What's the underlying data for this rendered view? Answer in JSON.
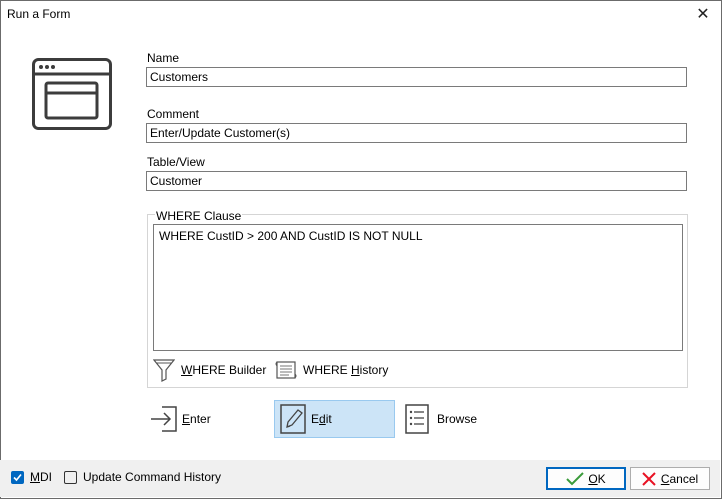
{
  "window": {
    "title": "Run a Form"
  },
  "fields": {
    "name": {
      "label": "Name",
      "value": "Customers"
    },
    "comment": {
      "label": "Comment",
      "value": "Enter/Update Customer(s)"
    },
    "table": {
      "label": "Table/View",
      "value": "Customer"
    }
  },
  "where": {
    "group_label": "WHERE Clause",
    "clause": "WHERE  CustID  > 200 AND  CustID  IS NOT NULL",
    "builder_hotkey": "W",
    "builder_rest": "HERE Builder",
    "history_prefix": "WHERE ",
    "history_hotkey": "H",
    "history_rest": "istory"
  },
  "modes": {
    "enter_hotkey": "E",
    "enter_rest": "nter",
    "edit_pre": "E",
    "edit_hotkey": "d",
    "edit_rest": "it",
    "browse_label": "Browse",
    "selected": "Edit"
  },
  "options": {
    "mdi_label": "MDI",
    "mdi_hotkey": "M",
    "mdi_rest": "DI",
    "mdi_checked": true,
    "history_label": "Update Command History",
    "history_checked": false
  },
  "buttons": {
    "ok_hotkey": "O",
    "ok_rest": "K",
    "cancel_hotkey": "C",
    "cancel_rest": "ancel"
  },
  "colors": {
    "accent": "#0067c0",
    "selected_bg": "#cce4f7",
    "footer_bg": "#f0f0f0",
    "cancel_icon": "#e81123",
    "ok_icon": "#3a9b3a"
  }
}
